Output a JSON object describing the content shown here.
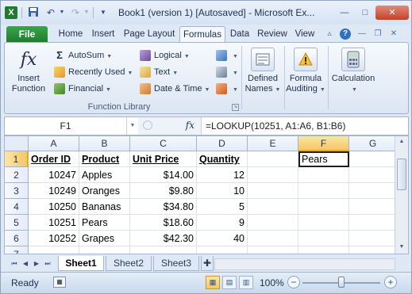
{
  "titlebar": {
    "title": "Book1 (version 1) [Autosaved] - Microsoft Ex...",
    "app_icon_letter": "X",
    "quick_access": [
      "save-icon",
      "undo-icon",
      "redo-icon",
      "customize-icon"
    ],
    "window_buttons": [
      "minimize-icon",
      "maximize-icon",
      "close-icon"
    ]
  },
  "tabs": {
    "file": "File",
    "items": [
      "Home",
      "Insert",
      "Page Layout",
      "Formulas",
      "Data",
      "Review",
      "View"
    ],
    "active": "Formulas"
  },
  "ribbon": {
    "insert_function": {
      "icon": "fx",
      "label_line1": "Insert",
      "label_line2": "Function"
    },
    "col1": [
      {
        "label": "AutoSum",
        "icon": "sigma-icon",
        "symbol": "Σ"
      },
      {
        "label": "Recently Used",
        "icon": "recently-used-icon"
      },
      {
        "label": "Financial",
        "icon": "financial-icon"
      }
    ],
    "col2": [
      {
        "label": "Logical",
        "icon": "logical-icon"
      },
      {
        "label": "Text",
        "icon": "text-icon"
      },
      {
        "label": "Date & Time",
        "icon": "date-time-icon"
      }
    ],
    "group_label": "Function Library",
    "defined_names": {
      "line1": "Defined",
      "line2": "Names"
    },
    "formula_auditing": {
      "line1": "Formula",
      "line2": "Auditing"
    },
    "calculation": {
      "line1": "Calculation"
    }
  },
  "formula_bar": {
    "name_box": "F1",
    "fx": "fx",
    "formula": "=LOOKUP(10251, A1:A6, B1:B6)"
  },
  "sheet": {
    "columns": [
      "A",
      "B",
      "C",
      "D",
      "E",
      "F",
      "G"
    ],
    "rows": [
      "1",
      "2",
      "3",
      "4",
      "5",
      "6",
      "7"
    ],
    "headers": [
      "Order ID",
      "Product",
      "Unit Price",
      "Quantity"
    ],
    "data": [
      [
        "10247",
        "Apples",
        "$14.00",
        "12"
      ],
      [
        "10249",
        "Oranges",
        "$9.80",
        "10"
      ],
      [
        "10250",
        "Bananas",
        "$34.80",
        "5"
      ],
      [
        "10251",
        "Pears",
        "$18.60",
        "9"
      ],
      [
        "10252",
        "Grapes",
        "$42.30",
        "40"
      ]
    ],
    "active_cell_value": "Pears",
    "selected_column": "F",
    "selected_row": "1"
  },
  "sheet_tabs": {
    "tabs": [
      "Sheet1",
      "Sheet2",
      "Sheet3"
    ],
    "active": "Sheet1"
  },
  "status": {
    "ready": "Ready",
    "zoom": "100%",
    "zoom_minus": "−",
    "zoom_plus": "+",
    "zoom_level": 0.5
  }
}
